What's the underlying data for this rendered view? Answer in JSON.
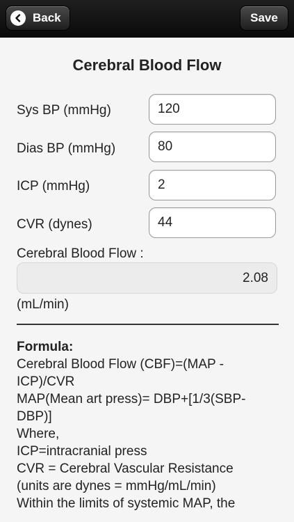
{
  "nav": {
    "back_label": "Back",
    "save_label": "Save"
  },
  "page": {
    "title": "Cerebral Blood Flow"
  },
  "inputs": [
    {
      "label": "Sys BP (mmHg)",
      "value": "120"
    },
    {
      "label": "Dias BP (mmHg)",
      "value": "80"
    },
    {
      "label": "ICP (mmHg)",
      "value": "2"
    },
    {
      "label": "CVR (dynes)",
      "value": "44"
    }
  ],
  "result": {
    "label": "Cerebral Blood Flow :",
    "value": "2.08",
    "unit": "(mL/min)"
  },
  "formula": {
    "title": "Formula:",
    "lines": [
      "Cerebral Blood Flow (CBF)=(MAP -",
      "ICP)/CVR",
      "MAP(Mean art press)= DBP+[1/3(SBP-",
      "DBP)]",
      "Where,",
      "ICP=intracranial press",
      "CVR = Cerebral Vascular Resistance",
      "(units are dynes = mmHg/mL/min)",
      "Within the limits of systemic MAP, the"
    ]
  }
}
